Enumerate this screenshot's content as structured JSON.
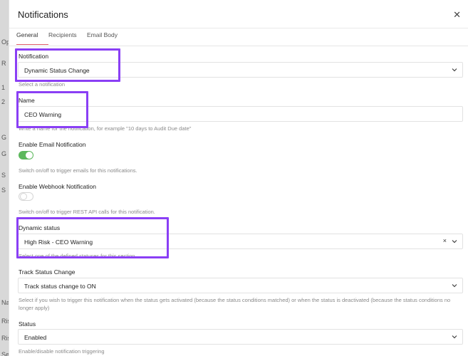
{
  "background": {
    "fragments": [
      "Ope",
      "R",
      "1",
      "2",
      "G",
      "G",
      "S",
      "S",
      "Na",
      "Ris",
      "Ris",
      "Se"
    ]
  },
  "modal": {
    "title": "Notifications",
    "close_icon": "close-icon",
    "tabs": [
      {
        "label": "General",
        "active": true
      },
      {
        "label": "Recipients",
        "active": false
      },
      {
        "label": "Email Body",
        "active": false
      }
    ]
  },
  "form": {
    "notification": {
      "label": "Notification",
      "value": "Dynamic Status Change",
      "help": "Select a notification"
    },
    "name": {
      "label": "Name",
      "value": "CEO Warning",
      "help": "Write a name for the notification, for example \"10 days to Audit Due date\""
    },
    "enable_email": {
      "label": "Enable Email Notification",
      "state": "on",
      "help": "Switch on/off to trigger emails for this notifications."
    },
    "enable_webhook": {
      "label": "Enable Webhook Notification",
      "state": "off",
      "help": "Switch on/off to trigger REST API calls for this notification."
    },
    "dynamic_status": {
      "label": "Dynamic status",
      "value": "High Risk - CEO Warning",
      "clear": "×",
      "help": "Select one of the defined statuses for this section"
    },
    "track_status_change": {
      "label": "Track Status Change",
      "value": "Track status change to ON",
      "help_line1": "Select if you wish to trigger this notification when the status gets activated (because the status conditions matched) or when the status is deactivated (because the status conditions no",
      "help_line2": "longer apply)"
    },
    "status": {
      "label": "Status",
      "value": "Enabled",
      "help": "Enable/disable notification triggering"
    }
  },
  "colors": {
    "highlight": "#8a3ff5",
    "toggle_on": "#5cb85c",
    "tab_underline": "#e05b6a"
  }
}
